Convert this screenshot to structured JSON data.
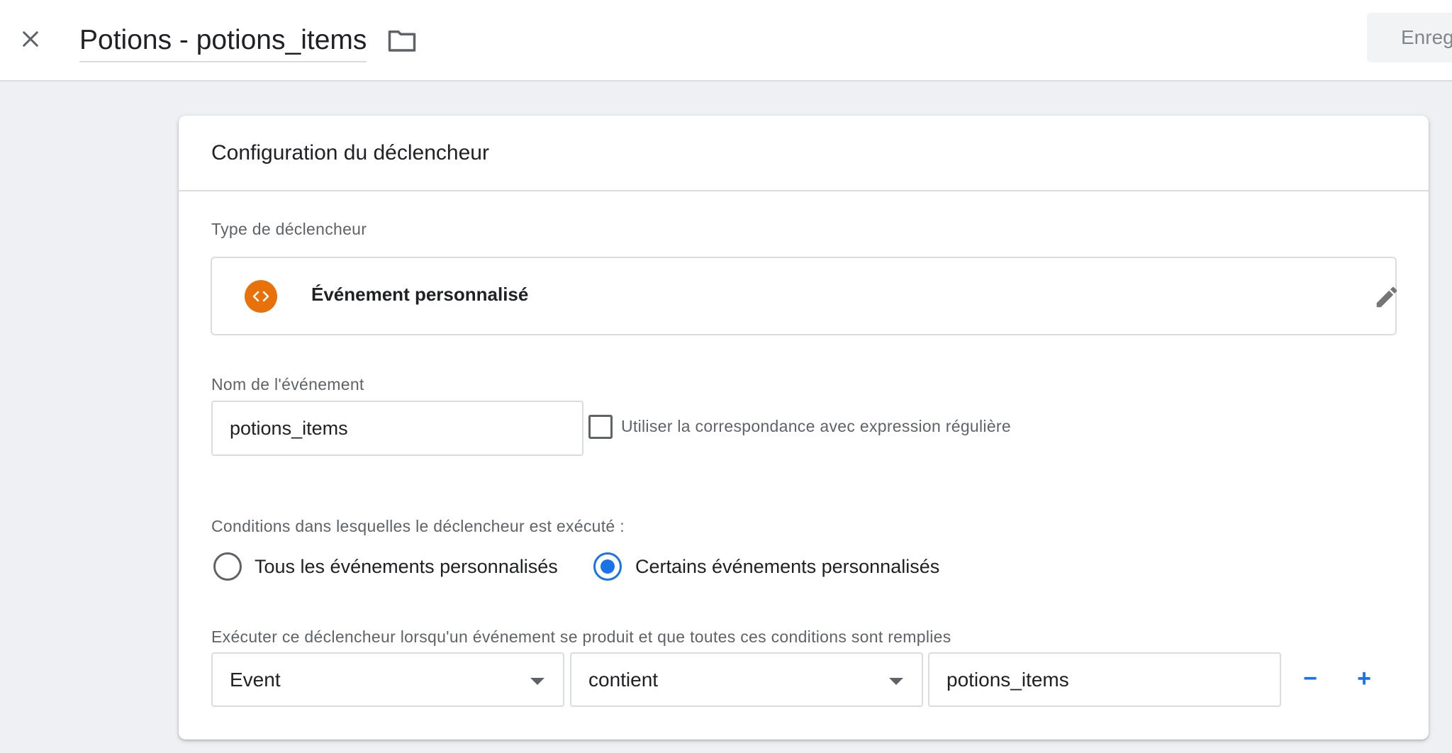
{
  "header": {
    "title": "Potions - potions_items",
    "save_label": "Enregistrer"
  },
  "card": {
    "title": "Configuration du déclencheur",
    "trigger_type_label": "Type de déclencheur",
    "trigger_type_name": "Événement personnalisé",
    "event_name_label": "Nom de l'événement",
    "event_name_value": "potions_items",
    "regex_label": "Utiliser la correspondance avec expression régulière",
    "conditions_label": "Conditions dans lesquelles le déclencheur est exécuté :",
    "radio_all": "Tous les événements personnalisés",
    "radio_some": "Certains événements personnalisés",
    "rule_label": "Exécuter ce déclencheur lorsqu'un événement se produit et que toutes ces conditions sont remplies",
    "rule": {
      "variable": "Event",
      "operator": "contient",
      "value": "potions_items"
    },
    "remove_label": "−",
    "add_label": "+"
  },
  "colors": {
    "accent": "#1a73e8",
    "trigger_icon": "#e8710a"
  }
}
